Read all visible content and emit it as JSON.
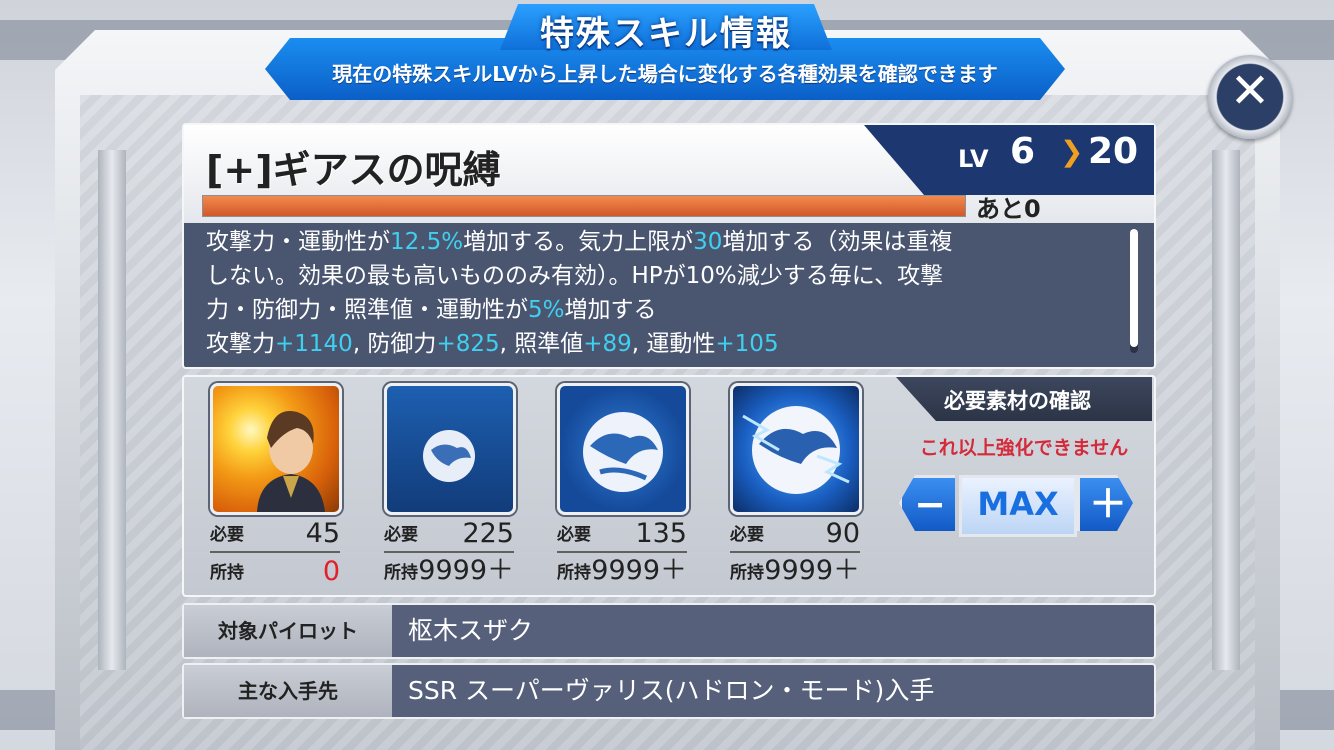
{
  "header": {
    "title": "特殊スキル情報",
    "subtitle": "現在の特殊スキルLVから上昇した場合に変化する各種効果を確認できます",
    "close_symbol": "✕"
  },
  "skill": {
    "name": "[+]ギアスの呪縛",
    "lv_label": "LV",
    "current_level": "6",
    "level_arrow": "❯",
    "target_level": "20",
    "remaining": "あと0",
    "progress": 1.0,
    "description": {
      "l1a": "攻撃力・運動性が",
      "l1b": "12.5%",
      "l1c": "増加する。気力上限が",
      "l1d": "30",
      "l1e": "増加する（効果は重複",
      "l2": "しない。効果の最も高いもののみ有効）。HPが10%減少する毎に、攻撃",
      "l3a": "力・防御力・照準値・運動性が",
      "l3b": "5%",
      "l3c": "増加する",
      "l4a": "攻撃力",
      "l4b": "+1140",
      "l4c": ", 防御力",
      "l4d": "+825",
      "l4e": ", 照準値",
      "l4f": "+89",
      "l4g": ", 運動性",
      "l4h": "+105"
    }
  },
  "materials": {
    "required_label": "必要",
    "owned_label": "所持",
    "items": [
      {
        "icon": "pilot-portrait",
        "required": "45",
        "owned": "0"
      },
      {
        "icon": "small-orb",
        "required": "225",
        "owned": "9999＋"
      },
      {
        "icon": "medium-orb",
        "required": "135",
        "owned": "9999＋"
      },
      {
        "icon": "large-orb",
        "required": "90",
        "owned": "9999＋"
      }
    ],
    "confirm_header": "必要素材の確認",
    "warning": "これ以上強化できません",
    "minus": "−",
    "max": "MAX",
    "plus": "＋"
  },
  "info": {
    "pilot_label": "対象パイロット",
    "pilot_value": "枢木スザク",
    "source_label": "主な入手先",
    "source_value": "SSR スーパーヴァリス(ハドロン・モード)入手"
  },
  "colors": {
    "highlight": "#3fd0f0",
    "warning": "#d42a3a",
    "banner": "#0b5fc7",
    "owned_zero": "#e0202a"
  }
}
